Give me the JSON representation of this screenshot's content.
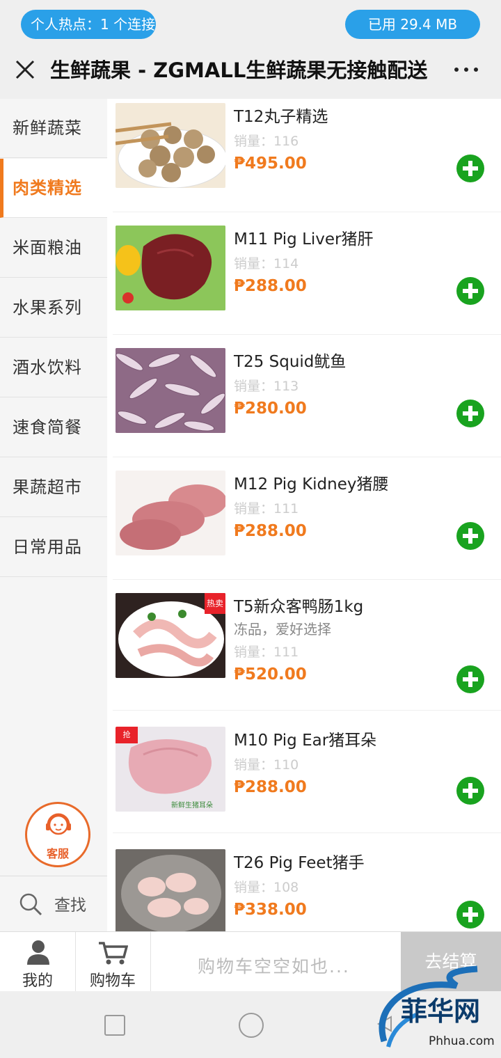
{
  "status": {
    "hotspot": "个人热点：1 个连接",
    "data_used": "已用 29.4 MB"
  },
  "header": {
    "title": "生鲜蔬果 - ZGMALL生鲜蔬果无接触配送"
  },
  "sidebar": {
    "items": [
      {
        "label": "新鲜蔬菜",
        "active": false
      },
      {
        "label": "肉类精选",
        "active": true
      },
      {
        "label": "米面粮油",
        "active": false
      },
      {
        "label": "水果系列",
        "active": false
      },
      {
        "label": "酒水饮料",
        "active": false
      },
      {
        "label": "速食简餐",
        "active": false
      },
      {
        "label": "果蔬超市",
        "active": false
      },
      {
        "label": "日常用品",
        "active": false
      }
    ],
    "customer_service": "客服",
    "search": "查找"
  },
  "products": [
    {
      "name": "T12丸子精选",
      "sales": "销量：116",
      "price": "₱495.00"
    },
    {
      "name": "M11 Pig Liver猪肝",
      "sales": "销量：114",
      "price": "₱288.00"
    },
    {
      "name": "T25 Squid鱿鱼",
      "sales": "销量：113",
      "price": "₱280.00"
    },
    {
      "name": "M12 Pig Kidney猪腰",
      "sales": "销量：111",
      "price": "₱288.00"
    },
    {
      "name": "T5新众客鸭肠1kg",
      "desc": "冻品，爱好选择",
      "sales": "销量：111",
      "price": "₱520.00",
      "badge": "热卖"
    },
    {
      "name": "M10 Pig Ear猪耳朵",
      "sales": "销量：110",
      "price": "₱288.00",
      "badge": "抢",
      "img_caption": "新鲜生猪耳朵"
    },
    {
      "name": "T26 Pig Feet猪手",
      "sales": "销量：108",
      "price": "₱338.00"
    }
  ],
  "bottom_bar": {
    "mine": "我的",
    "cart": "购物车",
    "cart_empty": "购物车空空如也...",
    "checkout": "去结算"
  },
  "watermark": {
    "text": "菲华网",
    "url": "Phhua.com"
  },
  "colors": {
    "accent": "#f07a1e",
    "add_button": "#19a31f",
    "status_pill": "#2aa0e8"
  }
}
